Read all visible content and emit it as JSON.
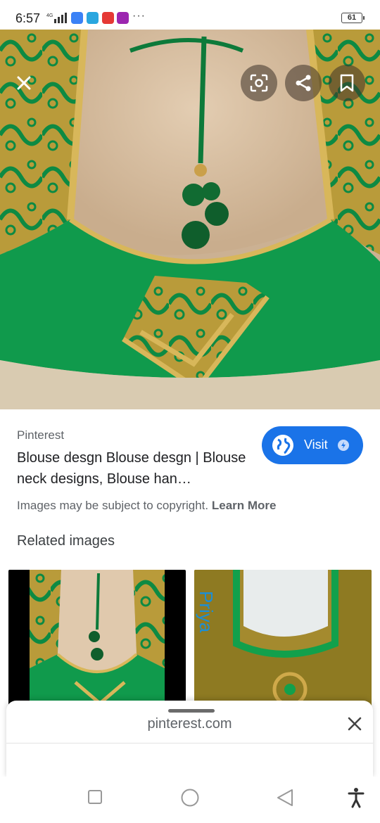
{
  "status_bar": {
    "time": "6:57",
    "network": "4G",
    "battery": "61",
    "more": "···"
  },
  "viewer": {
    "close_icon": "close-icon",
    "lens_icon": "lens-icon",
    "share_icon": "share-icon",
    "bookmark_icon": "bookmark-icon"
  },
  "result": {
    "source": "Pinterest",
    "title": "Blouse desgn Blouse desgn | Blouse neck designs, Blouse han…",
    "visit_label": "Visit",
    "copyright_text": "Images may be subject to copyright.",
    "learn_more": "Learn More"
  },
  "related": {
    "heading": "Related images",
    "thumb2_text": "Priya"
  },
  "sheet": {
    "url": "pinterest.com"
  },
  "colors": {
    "accent": "#1a73e8",
    "silk_green": "#0f9a4a",
    "gold": "#c9a640"
  }
}
